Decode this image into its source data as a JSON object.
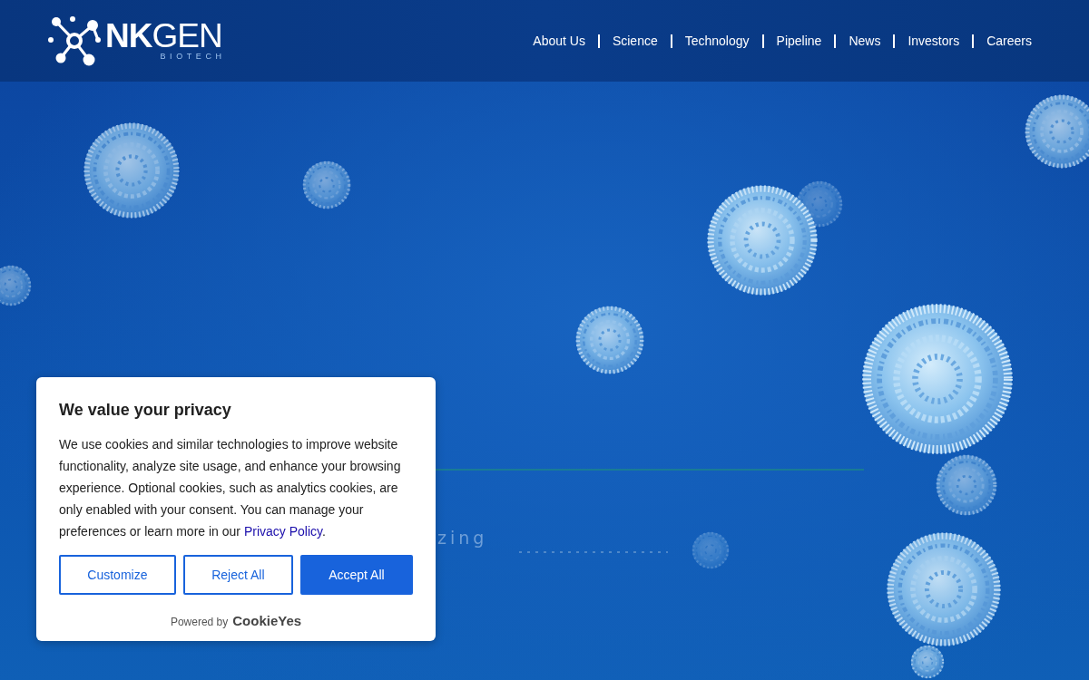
{
  "header": {
    "logo": {
      "wordmark": "**NK**GEN",
      "tagline": "BIOTECH"
    },
    "nav": [
      {
        "label": "About Us"
      },
      {
        "label": "Science"
      },
      {
        "label": "Technology"
      },
      {
        "label": "Pipeline"
      },
      {
        "label": "News"
      },
      {
        "label": "Investors"
      },
      {
        "label": "Careers"
      }
    ]
  },
  "hero": {
    "text_fragment": "zing"
  },
  "cookie_banner": {
    "title": "We value your privacy",
    "body": "We use cookies and similar technologies to improve website functionality, analyze site usage, and enhance your browsing experience. Optional cookies, such as analytics cookies, are only enabled with your consent. You can manage your preferences or learn more in our ",
    "link": "Privacy Policy",
    "after_link": ".",
    "buttons": [
      {
        "label": "Customize",
        "kind": "outline"
      },
      {
        "label": "Reject All",
        "kind": "outline"
      },
      {
        "label": "Accept All",
        "kind": "primary"
      }
    ],
    "powered_by": "Powered by",
    "brand": "CookieYes"
  }
}
